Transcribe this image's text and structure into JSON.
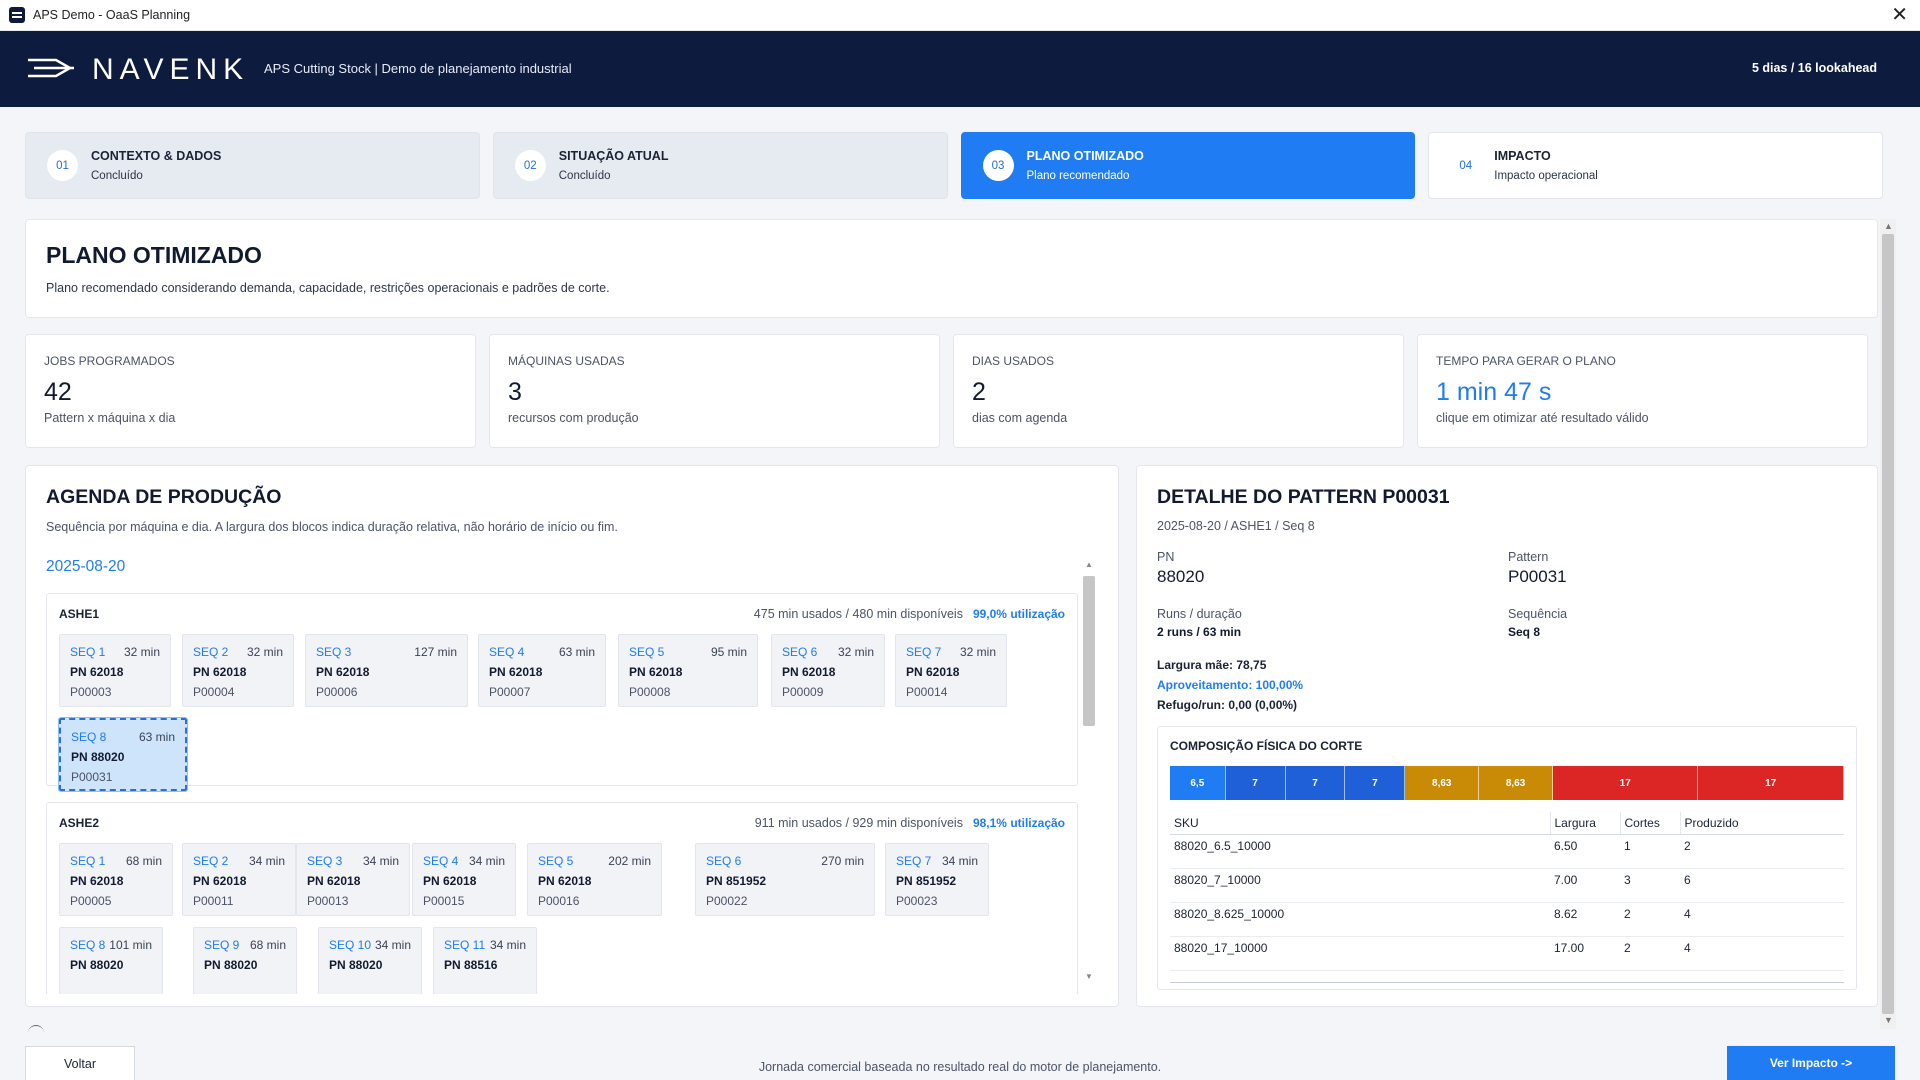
{
  "window": {
    "title": "APS Demo - OaaS Planning"
  },
  "header": {
    "brand": "NAVENK",
    "subtitle": "APS Cutting Stock | Demo de planejamento industrial",
    "lookahead": "5 dias / 16 lookahead"
  },
  "steps": [
    {
      "num": "01",
      "title": "CONTEXTO & DADOS",
      "status": "Concluído",
      "state": "done"
    },
    {
      "num": "02",
      "title": "SITUAÇÃO ATUAL",
      "status": "Concluído",
      "state": "done"
    },
    {
      "num": "03",
      "title": "PLANO OTIMIZADO",
      "status": "Plano recomendado",
      "state": "active"
    },
    {
      "num": "04",
      "title": "IMPACTO",
      "status": "Impacto operacional",
      "state": "pending"
    }
  ],
  "hero": {
    "title": "PLANO OTIMIZADO",
    "description": "Plano recomendado considerando demanda, capacidade, restrições operacionais e padrões de corte."
  },
  "kpis": [
    {
      "label": "JOBS PROGRAMADOS",
      "value": "42",
      "sub": "Pattern x máquina x dia"
    },
    {
      "label": "MÁQUINAS USADAS",
      "value": "3",
      "sub": "recursos com produção"
    },
    {
      "label": "DIAS USADOS",
      "value": "2",
      "sub": "dias com agenda"
    },
    {
      "label": "TEMPO PARA GERAR O PLANO",
      "value": "1 min 47 s",
      "sub": "clique em otimizar até resultado válido"
    }
  ],
  "agenda": {
    "title": "AGENDA DE PRODUÇÃO",
    "description": "Sequência por máquina e dia. A largura dos blocos indica duração relativa, não horário de início ou fim.",
    "date": "2025-08-20",
    "machines": [
      {
        "name": "ASHE1",
        "usage": "475 min usados / 480 min disponíveis",
        "utilization": "99,0% utilização",
        "blocks": [
          {
            "seq": "SEQ 1",
            "dur": "32 min",
            "pn": "PN 62018",
            "pattern": "P00003"
          },
          {
            "seq": "SEQ 2",
            "dur": "32 min",
            "pn": "PN 62018",
            "pattern": "P00004"
          },
          {
            "seq": "SEQ 3",
            "dur": "127 min",
            "pn": "PN 62018",
            "pattern": "P00006"
          },
          {
            "seq": "SEQ 4",
            "dur": "63 min",
            "pn": "PN 62018",
            "pattern": "P00007"
          },
          {
            "seq": "SEQ 5",
            "dur": "95 min",
            "pn": "PN 62018",
            "pattern": "P00008"
          },
          {
            "seq": "SEQ 6",
            "dur": "32 min",
            "pn": "PN 62018",
            "pattern": "P00009"
          },
          {
            "seq": "SEQ 7",
            "dur": "32 min",
            "pn": "PN 62018",
            "pattern": "P00014"
          },
          {
            "seq": "SEQ 8",
            "dur": "63 min",
            "pn": "PN 88020",
            "pattern": "P00031"
          }
        ]
      },
      {
        "name": "ASHE2",
        "usage": "911 min usados / 929 min disponíveis",
        "utilization": "98,1% utilização",
        "blocks": [
          {
            "seq": "SEQ 1",
            "dur": "68 min",
            "pn": "PN 62018",
            "pattern": "P00005"
          },
          {
            "seq": "SEQ 2",
            "dur": "34 min",
            "pn": "PN 62018",
            "pattern": "P00011"
          },
          {
            "seq": "SEQ 3",
            "dur": "34 min",
            "pn": "PN 62018",
            "pattern": "P00013"
          },
          {
            "seq": "SEQ 4",
            "dur": "34 min",
            "pn": "PN 62018",
            "pattern": "P00015"
          },
          {
            "seq": "SEQ 5",
            "dur": "202 min",
            "pn": "PN 62018",
            "pattern": "P00016"
          },
          {
            "seq": "SEQ 6",
            "dur": "270 min",
            "pn": "PN 851952",
            "pattern": "P00022"
          },
          {
            "seq": "SEQ 7",
            "dur": "34 min",
            "pn": "PN 851952",
            "pattern": "P00023"
          },
          {
            "seq": "SEQ 8",
            "dur": "101 min",
            "pn": "PN 88020",
            "pattern": ""
          },
          {
            "seq": "SEQ 9",
            "dur": "68 min",
            "pn": "PN 88020",
            "pattern": ""
          },
          {
            "seq": "SEQ 10",
            "dur": "34 min",
            "pn": "PN 88020",
            "pattern": ""
          },
          {
            "seq": "SEQ 11",
            "dur": "34 min",
            "pn": "PN 88516",
            "pattern": ""
          }
        ]
      }
    ]
  },
  "detail": {
    "title": "DETALHE DO PATTERN P00031",
    "sub": "2025-08-20 / ASHE1 / Seq 8",
    "pn_label": "PN",
    "pn_value": "88020",
    "pattern_label": "Pattern",
    "pattern_value": "P00031",
    "runs_label": "Runs / duração",
    "runs_value": "2 runs / 63 min",
    "seq_label": "Sequência",
    "seq_value": "Seq 8",
    "largura": "Largura mãe: 78,75",
    "aproveitamento": "Aproveitamento: 100,00%",
    "refugo": "Refugo/run: 0,00 (0,00%)",
    "composition_title": "COMPOSIÇÃO FÍSICA DO CORTE",
    "cuts": [
      {
        "label": "6,5",
        "width": 6.5,
        "color": "#1f7cf2"
      },
      {
        "label": "7",
        "width": 7,
        "color": "#1f5fd8"
      },
      {
        "label": "7",
        "width": 7,
        "color": "#1f5fd8"
      },
      {
        "label": "7",
        "width": 7,
        "color": "#1f5fd8"
      },
      {
        "label": "8,63",
        "width": 8.625,
        "color": "#c98a06"
      },
      {
        "label": "8,63",
        "width": 8.625,
        "color": "#c98a06"
      },
      {
        "label": "17",
        "width": 17,
        "color": "#dc2626"
      },
      {
        "label": "17",
        "width": 17,
        "color": "#dc2626"
      }
    ],
    "table": {
      "headers": [
        "SKU",
        "Largura",
        "Cortes",
        "Produzido"
      ],
      "rows": [
        [
          "88020_6.5_10000",
          "6.50",
          "1",
          "2"
        ],
        [
          "88020_7_10000",
          "7.00",
          "3",
          "6"
        ],
        [
          "88020_8.625_10000",
          "8.62",
          "2",
          "4"
        ],
        [
          "88020_17_10000",
          "17.00",
          "2",
          "4"
        ]
      ]
    }
  },
  "footer": {
    "back": "Voltar",
    "note": "Jornada comercial baseada no resultado real do motor de planejamento.",
    "next": "Ver Impacto ->"
  }
}
